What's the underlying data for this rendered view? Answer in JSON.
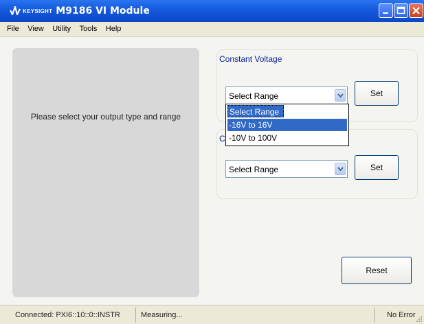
{
  "window": {
    "brand": "KEYSIGHT",
    "title": "M9186 VI Module",
    "colors": {
      "titlebar": "#1458dd",
      "group_label": "#0b1e9a",
      "selection": "#3169c6"
    }
  },
  "menu": {
    "items": [
      "File",
      "View",
      "Utility",
      "Tools",
      "Help"
    ]
  },
  "left_panel": {
    "message": "Please select your output type and range"
  },
  "constant_voltage": {
    "label": "Constant  Voltage",
    "select_value": "Select Range",
    "set_label": "Set",
    "dropdown_options": [
      "Select Range",
      "-16V to 16V",
      "-10V to 100V"
    ],
    "highlighted_option": "-16V to 16V"
  },
  "constant_current": {
    "label": "C",
    "select_value": "Select Range",
    "set_label": "Set"
  },
  "reset_label": "Reset",
  "status": {
    "connection": "Connected: PXI6::10::0::INSTR",
    "state": "Measuring...",
    "error": "No Error"
  },
  "icons": [
    "keysight-logo-icon",
    "minimize-icon",
    "maximize-icon",
    "close-icon",
    "chevron-down-icon",
    "resize-grip-icon"
  ]
}
